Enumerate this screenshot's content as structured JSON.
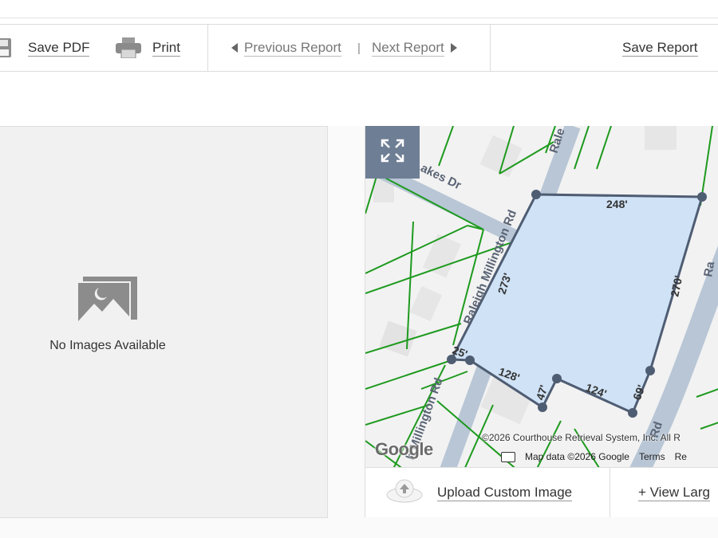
{
  "toolbar": {
    "save_pdf": "Save PDF",
    "print": "Print",
    "previous_report": "Previous Report",
    "separator": "|",
    "next_report": "Next Report",
    "save_report": "Save Report"
  },
  "images_panel": {
    "no_images_text": "No Images Available",
    "icon": "no-image-icon"
  },
  "map": {
    "roads": [
      {
        "label": "Lakes Dr"
      },
      {
        "label": "Raleigh Millington Rd"
      },
      {
        "label": "Rale"
      },
      {
        "label": "h Millington Rd"
      },
      {
        "label": "Ra"
      },
      {
        "label": "Rd"
      }
    ],
    "parcel_dimensions": [
      "248'",
      "270'",
      "273'",
      "25'",
      "128'",
      "47'",
      "124'",
      "69'"
    ],
    "attribution": "©2026 Courthouse Retrieval System, Inc. All R",
    "google_logo": "Google",
    "map_data": "Map data ©2026 Google",
    "terms": "Terms",
    "report_short": "Re",
    "parcel_fill": "#cfe2f6",
    "parcel_stroke": "#4f5d73",
    "lot_line_color": "#1e9a1e"
  },
  "map_footer": {
    "upload_custom_image": "Upload Custom Image",
    "view_larger": "+ View Larg"
  }
}
